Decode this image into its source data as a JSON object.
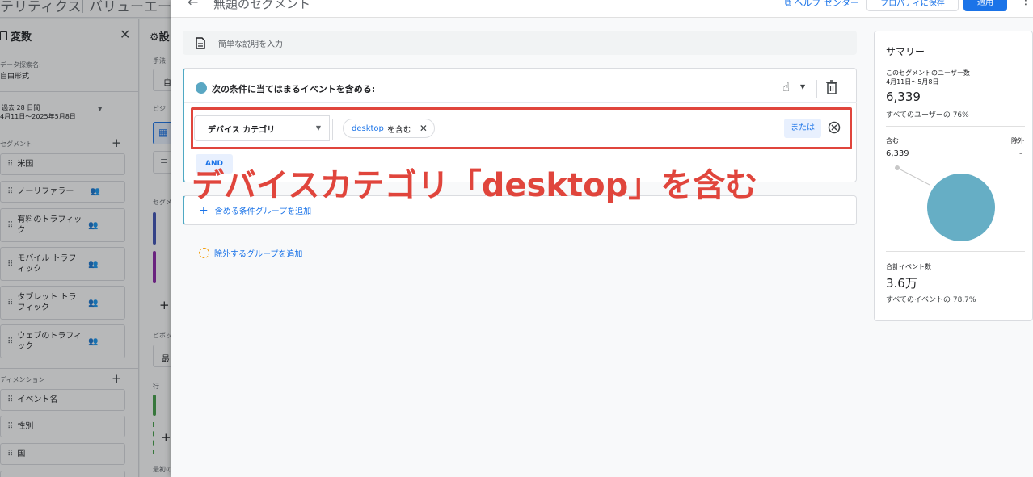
{
  "app": {
    "title_left": "テリティクス",
    "title_right": "バリューエージ"
  },
  "variables_panel": {
    "title": "変数",
    "exploration_name_label": "データ探索名:",
    "exploration_name_value": "自由形式",
    "date_range_label": "過去 28 日間",
    "date_range_value": "4月11日〜2025年5月8日",
    "segments_label": "セグメント",
    "segments": [
      "米国",
      "ノーリファラー",
      "有料のトラフィック",
      "モバイル トラフィック",
      "タブレット トラフィック",
      "ウェブのトラフィック"
    ],
    "dimensions_label": "ディメンション",
    "dimensions": [
      "イベント名",
      "性別",
      "国"
    ]
  },
  "settings_panel": {
    "title": "設",
    "labels": [
      "手法",
      "ビジ",
      "セグメ",
      "ピボッ",
      "行",
      "最初の"
    ],
    "box_texts": [
      "自",
      "最"
    ]
  },
  "modal": {
    "title": "無題のセグメント",
    "help_center": "ヘルプ センター",
    "save_to_property": "プロパティに保存",
    "apply": "適用",
    "description_placeholder": "簡単な説明を入力",
    "condition_title": "次の条件に当てはまるイベントを含める:",
    "dimension": "デバイス カテゴリ",
    "value": "desktop",
    "operator": "を含む",
    "or_label": "または",
    "and_label": "AND",
    "annotation": "デバイスカテゴリ「desktop」を含む",
    "add_include_group": "含める条件グループを追加",
    "add_exclude_group": "除外するグループを追加"
  },
  "summary": {
    "title": "サマリー",
    "users_label": "このセグメントのユーザー数",
    "users_date_range": "4月11日～5月8日",
    "users_value": "6,339",
    "users_pct": "すべてのユーザーの 76%",
    "include_label": "含む",
    "exclude_label": "除外",
    "include_value": "6,339",
    "exclude_value": "-",
    "events_label": "合計イベント数",
    "events_value": "3.6万",
    "events_pct": "すべてのイベントの 78.7%"
  },
  "colors": {
    "accent": "#1a73e8",
    "annotation": "#e0453c",
    "pie": "#66aec5",
    "condition_border": "#4fa9c4"
  },
  "icons": {
    "back": "arrow-left-icon",
    "help": "external-link-icon",
    "more": "more-vert-icon",
    "description": "document-icon",
    "hand": "pointer-hand-icon",
    "trash": "trash-icon",
    "remove": "remove-circle-icon",
    "add": "plus-icon"
  }
}
